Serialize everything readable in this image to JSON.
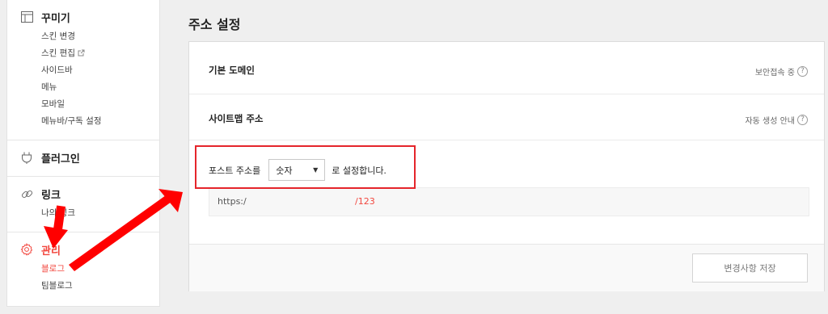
{
  "sidebar": {
    "decorate": {
      "title": "꾸미기",
      "items": [
        "스킨 변경",
        "스킨 편집",
        "사이드바",
        "메뉴",
        "모바일",
        "메뉴바/구독 설정"
      ]
    },
    "plugin": {
      "title": "플러그인"
    },
    "link": {
      "title": "링크",
      "items": [
        "나의 링크"
      ]
    },
    "manage": {
      "title": "관리",
      "items": [
        "블로그",
        "팀블로그"
      ]
    }
  },
  "main": {
    "title": "주소 설정",
    "rows": [
      {
        "label": "기본 도메인",
        "right": "보안접속 중"
      },
      {
        "label": "사이트맵 주소",
        "right": "자동 생성 안내"
      }
    ],
    "post_address": {
      "prefix": "포스트 주소를",
      "selected": "숫자",
      "suffix": "로 설정합니다."
    },
    "url_preview": {
      "scheme": "https:/",
      "suffix": "/123"
    },
    "save_label": "변경사항 저장"
  },
  "icons": {
    "decorate": "layout-icon",
    "plugin": "plug-icon",
    "link": "link-icon",
    "manage": "gear-icon",
    "external": "external-link-icon",
    "help": "help-circle-icon"
  },
  "colors": {
    "accent": "#f2473f",
    "highlight": "#e5252b",
    "arrow": "#ff0000"
  }
}
